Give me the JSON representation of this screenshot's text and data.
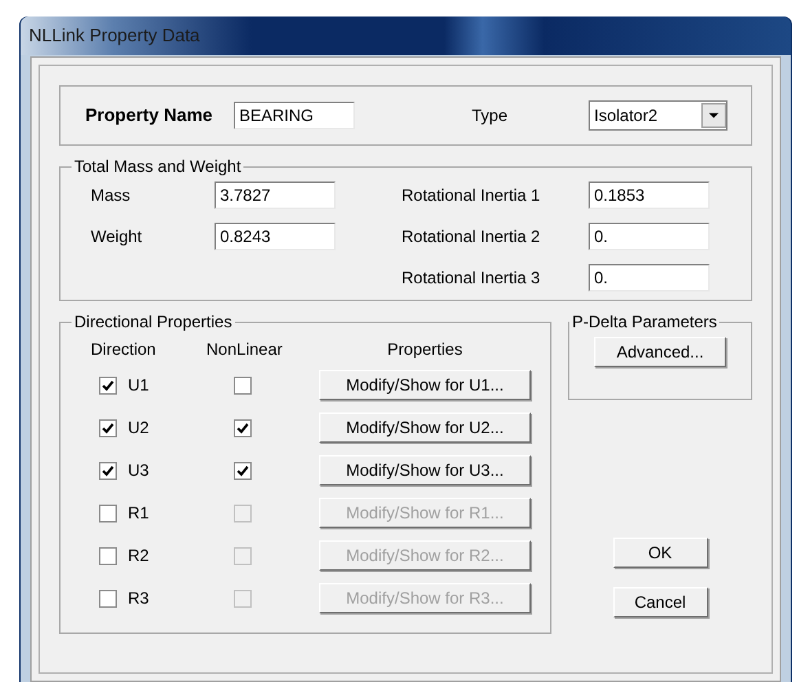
{
  "window": {
    "title": "NLLink Property Data"
  },
  "property": {
    "label": "Property Name",
    "value": "BEARING",
    "type_label": "Type",
    "type_value": "Isolator2"
  },
  "mass_group": {
    "title": "Total Mass and Weight",
    "fields": [
      {
        "label": "Mass",
        "value": "3.7827"
      },
      {
        "label": "Weight",
        "value": "0.8243"
      }
    ],
    "inertia": [
      {
        "label": "Rotational Inertia 1",
        "value": "0.1853"
      },
      {
        "label": "Rotational Inertia 2",
        "value": "0."
      },
      {
        "label": "Rotational Inertia 3",
        "value": "0."
      }
    ]
  },
  "directional": {
    "title": "Directional Properties",
    "headers": [
      "Direction",
      "NonLinear",
      "Properties"
    ],
    "rows": [
      {
        "direction": "U1",
        "checked": true,
        "nonlinear": false,
        "disabled": false,
        "button": "Modify/Show for U1..."
      },
      {
        "direction": "U2",
        "checked": true,
        "nonlinear": true,
        "disabled": false,
        "button": "Modify/Show for U2..."
      },
      {
        "direction": "U3",
        "checked": true,
        "nonlinear": true,
        "disabled": false,
        "button": "Modify/Show for U3..."
      },
      {
        "direction": "R1",
        "checked": false,
        "nonlinear": false,
        "disabled": true,
        "button": "Modify/Show for R1..."
      },
      {
        "direction": "R2",
        "checked": false,
        "nonlinear": false,
        "disabled": true,
        "button": "Modify/Show for R2..."
      },
      {
        "direction": "R3",
        "checked": false,
        "nonlinear": false,
        "disabled": true,
        "button": "Modify/Show for R3..."
      }
    ]
  },
  "pdelta": {
    "title": "P-Delta Parameters",
    "button": "Advanced..."
  },
  "buttons": [
    "OK",
    "Cancel"
  ]
}
